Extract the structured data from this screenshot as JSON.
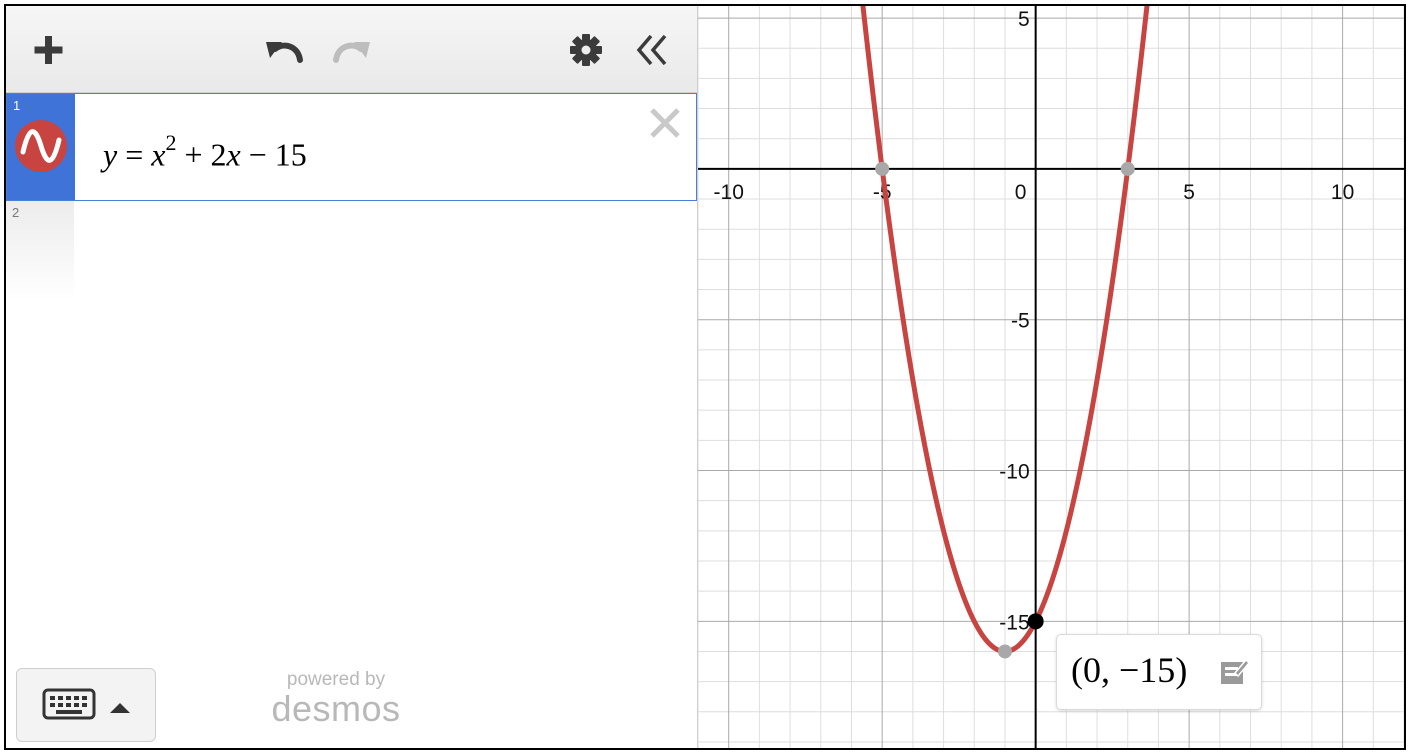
{
  "app": {
    "brand_line1": "powered by",
    "brand_line2": "desmos"
  },
  "toolbar": {
    "add_icon": "plus-icon",
    "undo_icon": "undo-icon",
    "redo_icon": "redo-icon",
    "settings_icon": "gear-icon",
    "collapse_icon": "double-chevron-left-icon"
  },
  "expressions": [
    {
      "number": "1",
      "lhs": "y",
      "eq": "=",
      "base": "x",
      "exponent": "2",
      "rest_op1": "+",
      "rest_coef": "2",
      "rest_var": "x",
      "rest_op2": "−",
      "rest_const": "15",
      "color": "#c74440",
      "icon": "sine-wave-icon",
      "delete_icon": "close-icon"
    },
    {
      "number": "2"
    }
  ],
  "keyboard": {
    "icon": "keyboard-icon",
    "toggle_icon": "triangle-up-icon"
  },
  "graph": {
    "x_ticks": [
      "-10",
      "-5",
      "0",
      "5",
      "10"
    ],
    "y_ticks": [
      "5",
      "-5",
      "-10",
      "-15"
    ],
    "curve_color": "#c74440",
    "point_label": {
      "open": "(",
      "x": "0",
      "sep": ",",
      "y": "−15",
      "close": ")",
      "icon": "edit-label-icon"
    }
  },
  "chart_data": {
    "type": "line",
    "expression": "y = x^2 + 2x - 15",
    "xlim": [
      -11,
      12
    ],
    "ylim": [
      -19.2,
      5.4
    ],
    "grid": true,
    "series": [
      {
        "function": "x^2 + 2x - 15",
        "color": "#c74440"
      }
    ],
    "points_of_interest": [
      {
        "x": -5,
        "y": 0,
        "kind": "x-intercept"
      },
      {
        "x": 3,
        "y": 0,
        "kind": "x-intercept"
      },
      {
        "x": -1,
        "y": -16,
        "kind": "vertex"
      },
      {
        "x": 0,
        "y": -15,
        "kind": "y-intercept",
        "selected": true
      }
    ]
  }
}
